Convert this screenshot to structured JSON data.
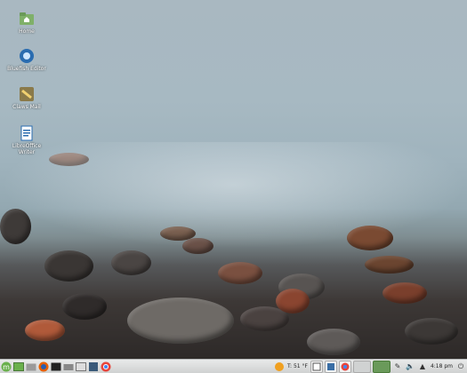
{
  "desktop_icons": [
    {
      "label": "Home",
      "icon": "home-folder-icon"
    },
    {
      "label": "Bluefish Editor",
      "icon": "bluefish-icon"
    },
    {
      "label": "Claws Mail",
      "icon": "mail-icon"
    },
    {
      "label": "LibreOffice Writer",
      "icon": "writer-icon"
    }
  ],
  "taskbar": {
    "launchers": [
      "menu",
      "show-desktop",
      "files",
      "terminal",
      "firefox",
      "terminal-2",
      "drive",
      "window",
      "firefox-2",
      "chrome"
    ],
    "weather": "T: 51 °F",
    "clock": "4:18 pm"
  },
  "colors": {
    "accent": "#6ab04c",
    "panel": "#dcdede"
  }
}
